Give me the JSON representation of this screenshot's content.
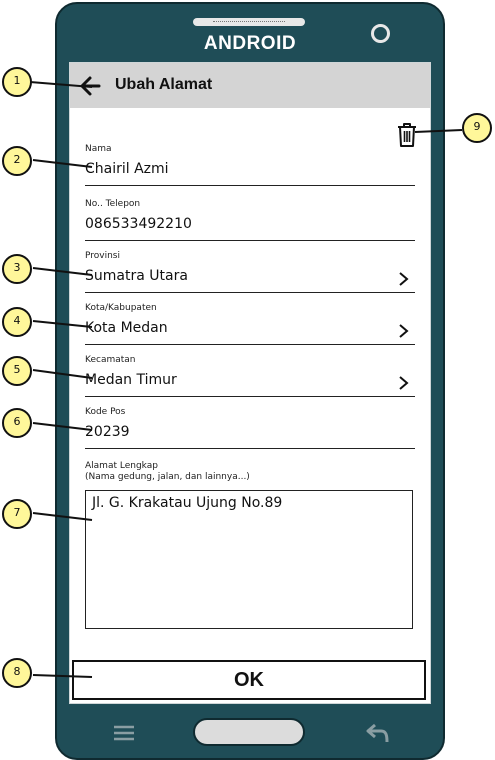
{
  "device": {
    "brand": "ANDROID"
  },
  "appbar": {
    "title": "Ubah Alamat"
  },
  "form": {
    "fields": [
      {
        "label": "Nama",
        "value": "Chairil Azmi"
      },
      {
        "label": "No.. Telepon",
        "value": "086533492210"
      },
      {
        "label": "Provinsi",
        "value": "Sumatra Utara"
      },
      {
        "label": "Kota/Kabupaten",
        "value": "Kota Medan"
      },
      {
        "label": "Kecamatan",
        "value": "Medan Timur"
      },
      {
        "label": "Kode Pos",
        "value": "20239"
      }
    ],
    "address": {
      "label": "Alamat Lengkap",
      "hint": "(Nama gedung, jalan, dan lainnya...)",
      "value": "Jl. G. Krakatau Ujung No.89"
    }
  },
  "ok_button": {
    "label": "OK"
  },
  "callouts": [
    "1",
    "2",
    "3",
    "4",
    "5",
    "6",
    "7",
    "8",
    "9"
  ],
  "colors": {
    "phone_body": "#1f4d57",
    "appbar": "#d4d4d4",
    "callout": "#fff79a"
  },
  "icons": [
    "back-arrow-icon",
    "trash-icon",
    "chevron-right-icon",
    "menu-icon",
    "home-button",
    "back-nav-icon"
  ]
}
